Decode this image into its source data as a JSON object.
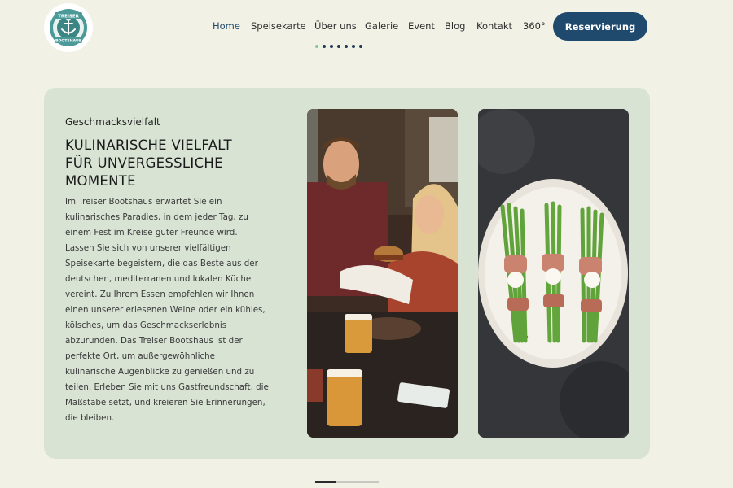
{
  "header": {
    "logo_top_text": "TREISER",
    "logo_bottom_text": "BOOTSHAUS",
    "nav": [
      {
        "label": "Home",
        "active": true
      },
      {
        "label": "Speisekarte",
        "active": false
      },
      {
        "label": "Über uns",
        "active": false
      },
      {
        "label": "Galerie",
        "active": false
      },
      {
        "label": "Event",
        "active": false
      },
      {
        "label": "Blog",
        "active": false
      },
      {
        "label": "Kontakt",
        "active": false
      },
      {
        "label": "360°",
        "active": false
      }
    ],
    "cta_label": "Reservierung",
    "dots_count": 7,
    "dots_active_index": 0
  },
  "section": {
    "eyebrow": "Geschmacksvielfalt",
    "headline_lines": [
      "KULINARISCHE VIELFALT",
      "FÜR UNVERGESSLICHE",
      "MOMENTE"
    ],
    "body_lines": [
      "Im Treiser Bootshaus erwartet Sie ein",
      "kulinarisches Paradies, in dem jeder Tag, zu",
      "einem Fest im Kreise guter Freunde wird.",
      "Lassen Sie sich von unserer vielfältigen",
      "Speisekarte begeistern, die das Beste aus der",
      "deutschen, mediterranen und lokalen Küche",
      "vereint. Zu Ihrem Essen empfehlen wir Ihnen",
      "einen unserer erlesenen Weine oder ein kühles,",
      "kölsches, um das Geschmackserlebnis",
      "abzurunden. Das Treiser Bootshaus ist der",
      "perfekte Ort, um außergewöhnliche",
      "kulinarische Augenblicke zu genießen und zu",
      "teilen. Erleben Sie mit uns Gastfreundschaft, die",
      "Maßstäbe setzt, und kreieren Sie Erinnerungen,",
      "die bleiben."
    ]
  },
  "slider": {
    "position_fraction": 0.33
  },
  "colors": {
    "background": "#f1f1e6",
    "card": "#d8e3d4",
    "primary": "#1f4a6e",
    "accent_dot": "#8cc2a9"
  },
  "icons": {
    "logo": "anchor-badge-icon"
  }
}
